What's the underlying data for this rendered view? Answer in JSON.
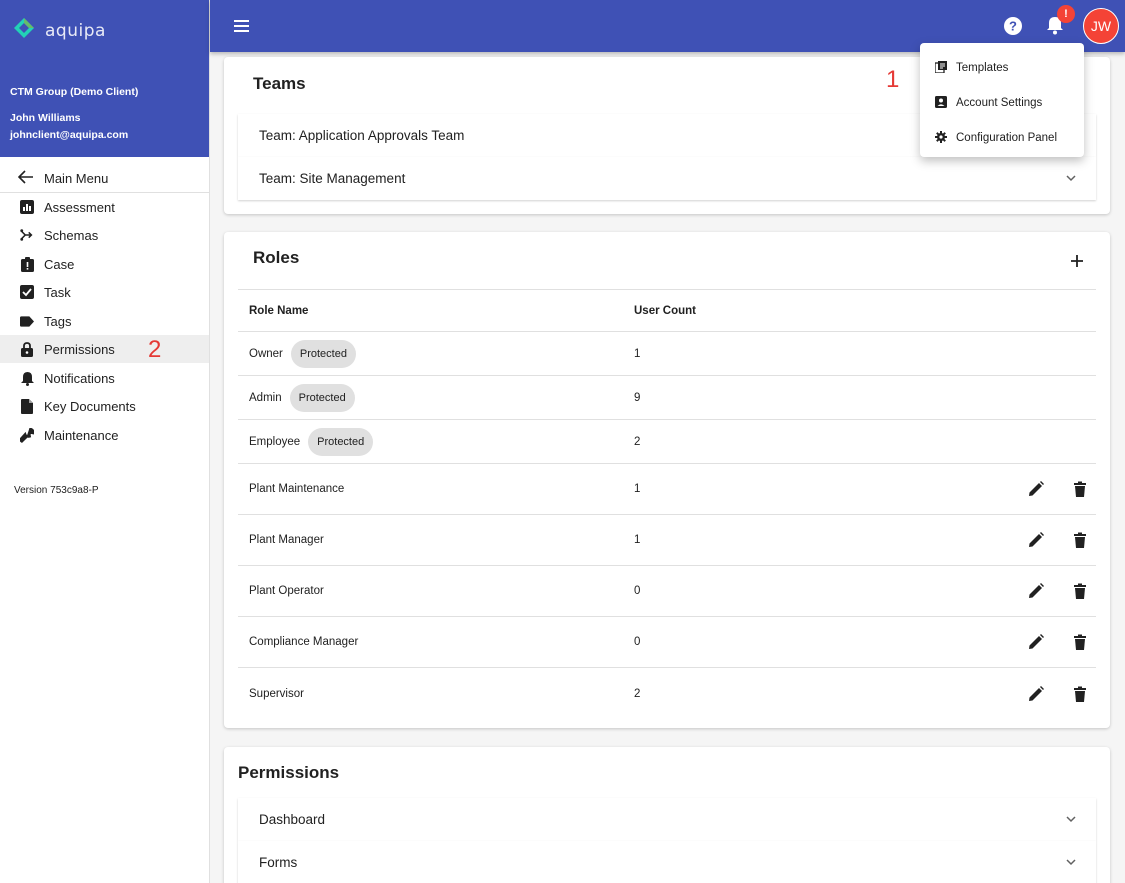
{
  "brand": {
    "name": "aquipa"
  },
  "user": {
    "client": "CTM Group (Demo Client)",
    "name": "John Williams",
    "email": "johnclient@aquipa.com",
    "initials": "JW"
  },
  "sidebar": {
    "main_menu": "Main Menu",
    "items": [
      {
        "label": "Assessment",
        "icon": "bar-chart-icon"
      },
      {
        "label": "Schemas",
        "icon": "schema-icon"
      },
      {
        "label": "Case",
        "icon": "clipboard-icon"
      },
      {
        "label": "Task",
        "icon": "checkbox-icon"
      },
      {
        "label": "Tags",
        "icon": "tag-icon"
      },
      {
        "label": "Permissions",
        "icon": "lock-icon",
        "active": true
      },
      {
        "label": "Notifications",
        "icon": "bell-icon"
      },
      {
        "label": "Key Documents",
        "icon": "document-icon"
      },
      {
        "label": "Maintenance",
        "icon": "wrench-icon"
      }
    ],
    "version": "Version 753c9a8-P"
  },
  "topbar": {
    "notification_badge": "!"
  },
  "annotations": {
    "marker_1": "1",
    "marker_2": "2"
  },
  "teams": {
    "title": "Teams",
    "items": [
      "Team: Application Approvals Team",
      "Team: Site Management"
    ]
  },
  "roles": {
    "title": "Roles",
    "col_name": "Role Name",
    "col_count": "User Count",
    "protected_label": "Protected",
    "rows": [
      {
        "name": "Owner",
        "count": "1",
        "protected": true
      },
      {
        "name": "Admin",
        "count": "9",
        "protected": true
      },
      {
        "name": "Employee",
        "count": "2",
        "protected": true
      },
      {
        "name": "Plant Maintenance",
        "count": "1",
        "protected": false
      },
      {
        "name": "Plant Manager",
        "count": "1",
        "protected": false
      },
      {
        "name": "Plant Operator",
        "count": "0",
        "protected": false
      },
      {
        "name": "Compliance Manager",
        "count": "0",
        "protected": false
      },
      {
        "name": "Supervisor",
        "count": "2",
        "protected": false
      }
    ]
  },
  "permissions": {
    "title": "Permissions",
    "items": [
      "Dashboard",
      "Forms"
    ]
  },
  "dropdown": {
    "items": [
      {
        "label": "Templates",
        "icon": "templates-icon"
      },
      {
        "label": "Account Settings",
        "icon": "account-box-icon"
      },
      {
        "label": "Configuration Panel",
        "icon": "gear-icon"
      }
    ]
  },
  "colors": {
    "primary": "#3f51b5",
    "accent": "#f44336",
    "brand_green": "#26a69a"
  }
}
